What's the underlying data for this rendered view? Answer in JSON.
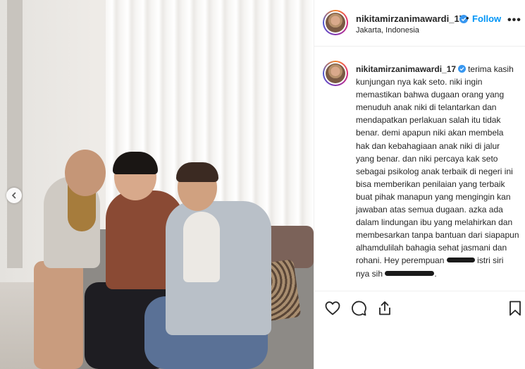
{
  "post": {
    "username": "nikitamirzanimawardi_17",
    "location": "Jakarta, Indonesia",
    "follow_label": "Follow",
    "separator": "•",
    "more_label": "•••",
    "caption_text_1": "terima kasih kunjungan nya kak seto. niki ingin memastikan bahwa dugaan orang yang menuduh anak niki di telantarkan dan mendapatkan perlakuan salah itu tidak benar. demi apapun niki akan membela hak dan kebahagiaan anak niki di jalur yang benar. dan niki percaya kak seto sebagai psikolog anak terbaik di negeri ini bisa memberikan penilaian yang terbaik buat pihak manapun yang mengingin kan jawaban atas semua dugaan. azka ada dalam lindungan ibu yang melahirkan dan membesarkan tanpa bantuan dari siapapun alhamdulilah bahagia sehat jasmani dan rohani. Hey perempuan",
    "caption_text_2": "istri siri nya sih",
    "caption_text_3": "."
  },
  "icons": {
    "verified": "verified-badge-icon",
    "carousel_prev": "chevron-left-icon",
    "like": "heart-icon",
    "comment": "comment-icon",
    "share": "share-icon",
    "save": "bookmark-icon"
  },
  "colors": {
    "accent": "#0095f6",
    "verified": "#3897f0",
    "text": "#262626",
    "border": "#efefef"
  }
}
